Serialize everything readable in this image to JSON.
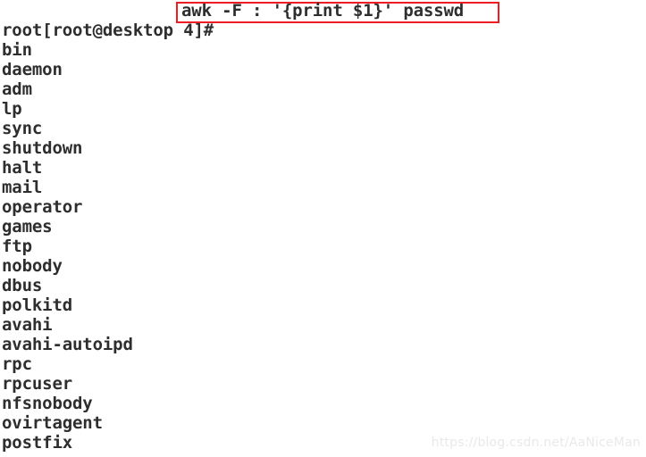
{
  "terminal": {
    "background_color": "#ffffff",
    "text_color": "#2e2e2e",
    "highlight_color": "#ee1d23",
    "prompt": "[root@desktop 4]#",
    "command": "awk -F : '{print $1}' passwd",
    "output_lines": [
      "root",
      "bin",
      "daemon",
      "adm",
      "lp",
      "sync",
      "shutdown",
      "halt",
      "mail",
      "operator",
      "games",
      "ftp",
      "nobody",
      "dbus",
      "polkitd",
      "avahi",
      "avahi-autoipd",
      "rpc",
      "rpcuser",
      "nfsnobody",
      "ovirtagent",
      "postfix"
    ]
  },
  "watermark": {
    "text": "https://blog.csdn.net/AaNiceMan",
    "color": "#e9e9e9"
  }
}
